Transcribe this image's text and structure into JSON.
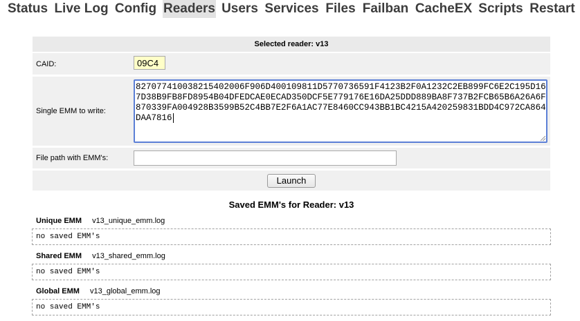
{
  "nav": {
    "items": [
      "Status",
      "Live Log",
      "Config",
      "Readers",
      "Users",
      "Services",
      "Files",
      "Failban",
      "CacheEX",
      "Scripts",
      "Restart"
    ],
    "active": "Readers"
  },
  "form": {
    "title": "Selected reader: v13",
    "caid_label": "CAID:",
    "caid_value": "09C4",
    "emm_label": "Single EMM to write:",
    "emm_value": "827077410038215402006F906D400109811D5770736591F4123B2F0A1232C2EB899FC6E2C195D167D38B9FB8FD8954B04DFEDCAE0ECAD350DCF5E779176E16DA25DDD889BA8F737B2FCB65B6A26A6F870339FA004928B3599B52C4BB7E2F6A1AC77E8460CC943BB1BC4215A420259831BDD4C972CA864DAA7816",
    "file_label": "File path with EMM's:",
    "file_value": "",
    "launch_label": "Launch"
  },
  "saved": {
    "title": "Saved EMM's for Reader: v13",
    "sections": [
      {
        "type": "Unique EMM",
        "file": "v13_unique_emm.log",
        "content": "no saved EMM's"
      },
      {
        "type": "Shared EMM",
        "file": "v13_shared_emm.log",
        "content": "no saved EMM's"
      },
      {
        "type": "Global EMM",
        "file": "v13_global_emm.log",
        "content": "no saved EMM's"
      }
    ]
  }
}
